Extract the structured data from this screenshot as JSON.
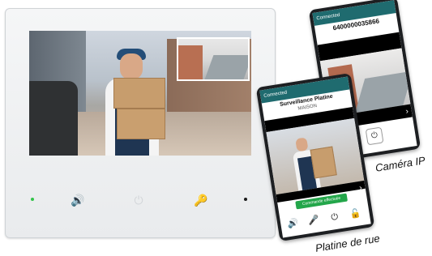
{
  "monitor": {
    "controls": {
      "speaker_icon": "speaker-icon",
      "power_icon": "power-icon",
      "key_icon": "key-icon"
    }
  },
  "phone_right": {
    "number": "6400000035866",
    "status_app": "Connected",
    "chevron_icon": "chevron-right-icon",
    "power_icon": "power-icon"
  },
  "phone_left": {
    "title": "Surveillance Platine",
    "subtitle": "MAISON",
    "status_app": "Connected",
    "command_button": "Commande effectuée",
    "chevron_icon": "chevron-right-icon"
  },
  "captions": {
    "camera": "Caméra IP",
    "street": "Platine de rue"
  }
}
